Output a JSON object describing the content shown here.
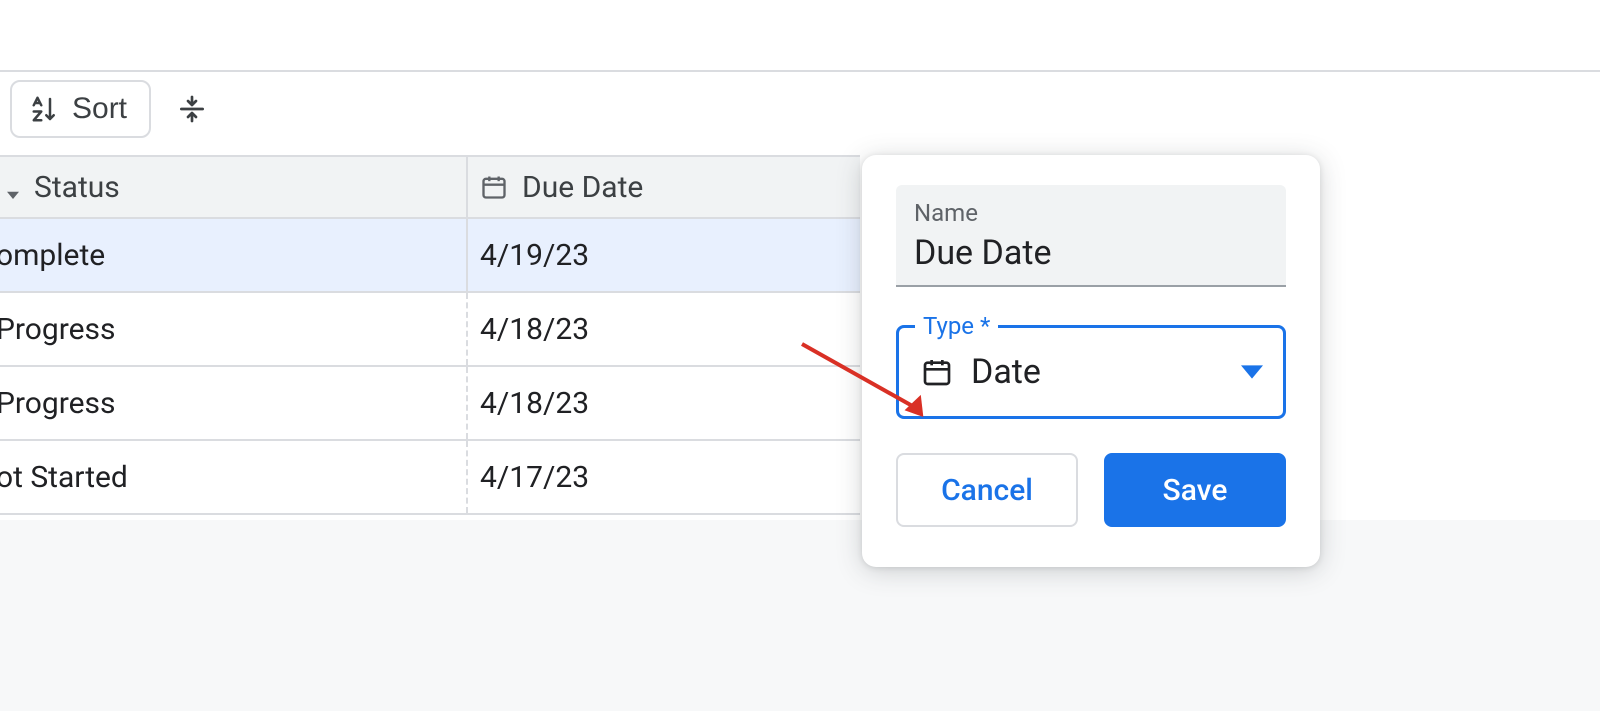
{
  "toolbar": {
    "sort_label": "Sort"
  },
  "columns": {
    "status_label": "Status",
    "due_date_label": "Due Date"
  },
  "rows": [
    {
      "status_suffix": "omplete",
      "due": "4/19/23",
      "selected": true
    },
    {
      "status_suffix": "Progress",
      "due": "4/18/23",
      "selected": false
    },
    {
      "status_suffix": "Progress",
      "due": "4/18/23",
      "selected": false
    },
    {
      "status_suffix": "ot Started",
      "due": "4/17/23",
      "selected": false
    }
  ],
  "popup": {
    "name_label": "Name",
    "name_value": "Due Date",
    "type_label": "Type *",
    "type_value": "Date",
    "cancel_label": "Cancel",
    "save_label": "Save"
  }
}
